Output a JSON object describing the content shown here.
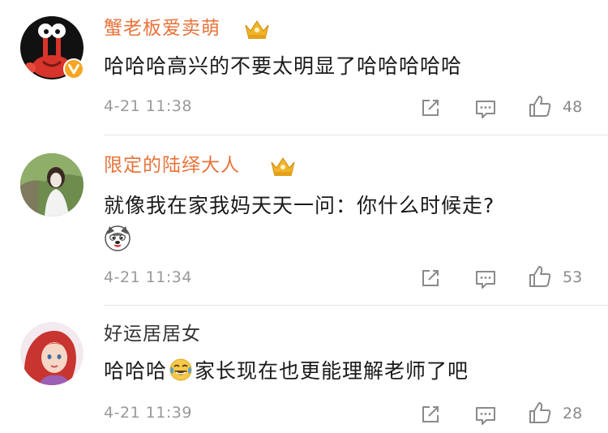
{
  "comments": [
    {
      "username": "蟹老板爱卖萌",
      "username_color": "#e8733b",
      "member_badge": "crown-icon",
      "verified_badge": "verified-v-icon",
      "text": "哈哈哈高兴的不要太明显了哈哈哈哈哈",
      "time": "4-21 11:38",
      "likes": "48"
    },
    {
      "username": "限定的陆绎大人",
      "username_color": "#e8733b",
      "member_badge": "crown-icon",
      "text": "就像我在家我妈天天一问：你什么时候走?",
      "emoji": "husky-emoji-icon",
      "time": "4-21 11:34",
      "likes": "53"
    },
    {
      "username": "好运居居女",
      "username_color": "#333333",
      "text_before": "哈哈哈",
      "emoji": "laughing-tears-emoji-icon",
      "text_after": "家长现在也更能理解老师了吧",
      "time": "4-21 11:39",
      "likes": "28"
    }
  ],
  "colors": {
    "accent": "#e8733b",
    "meta_gray": "#999999",
    "text": "#1a1a1a",
    "badge_gold": "#f0b429",
    "divider": "#e6e6e6"
  }
}
